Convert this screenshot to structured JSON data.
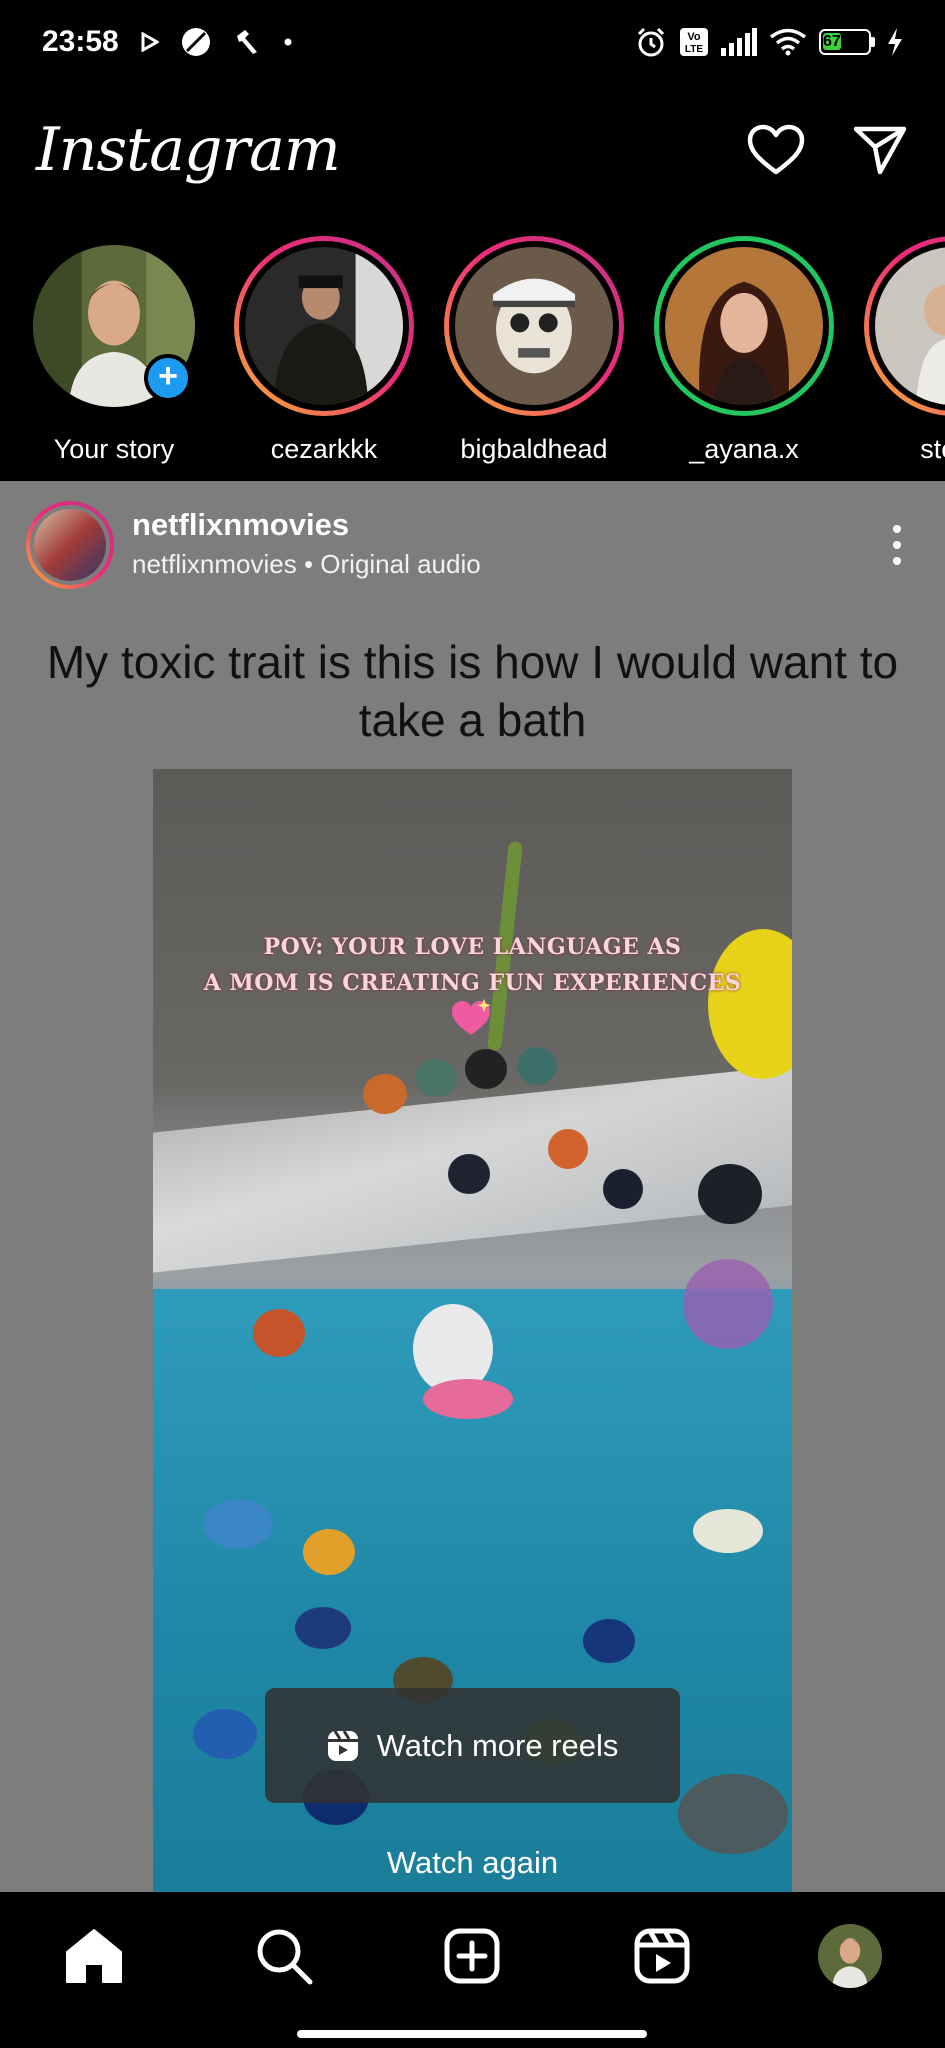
{
  "status_bar": {
    "time": "23:58",
    "icons": [
      "play-icon",
      "circle-slash-icon",
      "hammer-icon",
      "dot-icon",
      "alarm-icon",
      "volte-icon",
      "signal-icon",
      "wifi-icon",
      "battery-icon",
      "charging-icon"
    ],
    "battery_level": "67",
    "volte_label": "Vo LTE"
  },
  "header": {
    "logo": "Instagram",
    "icons": [
      "heart-icon",
      "send-icon"
    ]
  },
  "stories": [
    {
      "label": "Your story",
      "ring": "none",
      "has_add_badge": true
    },
    {
      "label": "cezarkkk",
      "ring": "gradient"
    },
    {
      "label": "bigbaldhead",
      "ring": "gradient"
    },
    {
      "label": "_ayana.x",
      "ring": "green"
    },
    {
      "label": "stefar",
      "ring": "gradient"
    }
  ],
  "post": {
    "username": "netflixnmovies",
    "subtitle": "netflixnmovies • Original audio",
    "caption": "My toxic trait is this is how I would want to take a bath",
    "video_overlay_line1": "POV: YOUR LOVE LANGUAGE AS",
    "video_overlay_line2": "A MOM IS CREATING FUN EXPERIENCES",
    "watch_more_label": "Watch more reels",
    "watch_again_label": "Watch again"
  },
  "bottom_nav": {
    "items": [
      "home-icon",
      "search-icon",
      "create-icon",
      "reels-icon",
      "profile-avatar"
    ]
  },
  "colors": {
    "story_green": "#22c55e",
    "add_badge_blue": "#1d9bf0",
    "battery_green": "#3ecf3a"
  }
}
